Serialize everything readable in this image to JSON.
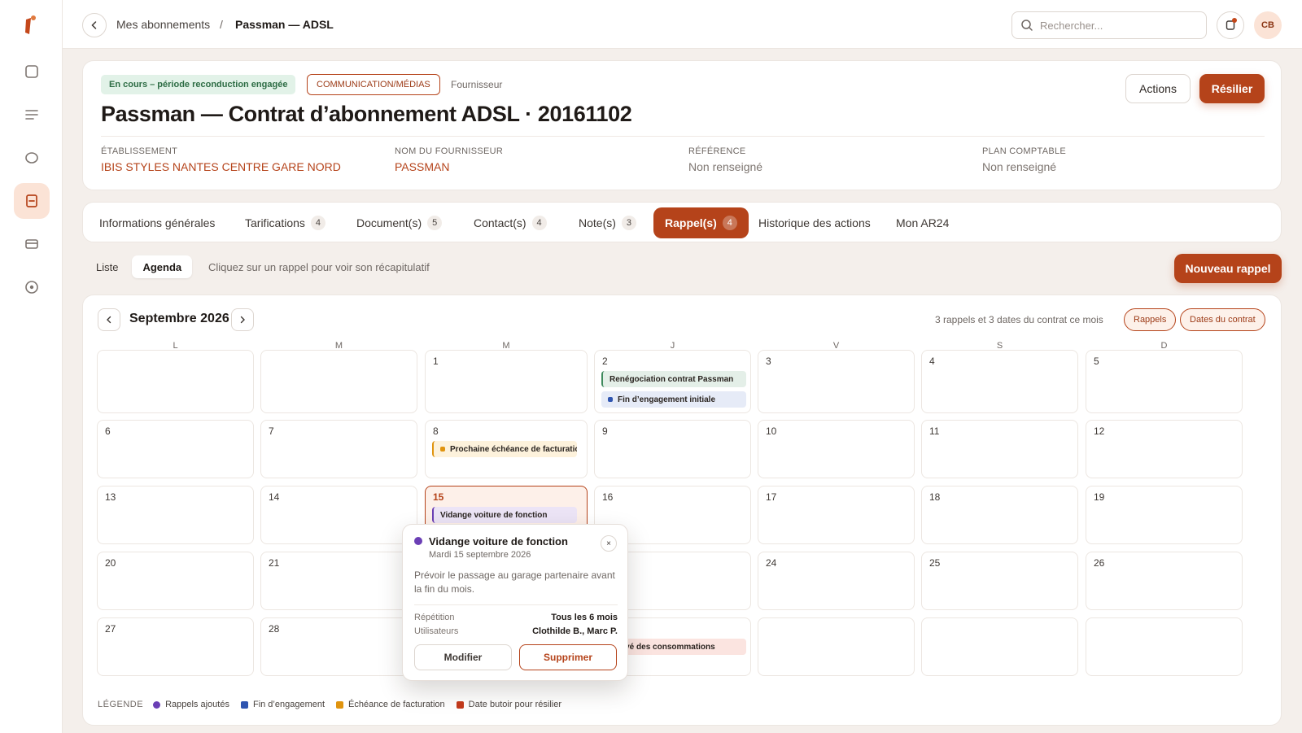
{
  "topbar": {
    "breadcrumb_parent": "Mes abonnements",
    "breadcrumb_separator": "/",
    "breadcrumb_current": "Passman — ADSL",
    "search_placeholder": "Rechercher...",
    "avatar_initials": "CB"
  },
  "sidebar": {
    "items": [
      {
        "icon": "square-icon"
      },
      {
        "icon": "list-icon"
      },
      {
        "icon": "circle-icon"
      },
      {
        "icon": "contract-icon",
        "active": true
      },
      {
        "icon": "card-icon"
      },
      {
        "icon": "target-icon"
      }
    ]
  },
  "header": {
    "status_badge": "En cours – période reconduction engagée",
    "category_badge": "COMMUNICATION/MÉDIAS",
    "supplier_tag": "Fournisseur",
    "title": "Passman — Contrat d’abonnement ADSL · 20161102",
    "actions_label": "Actions",
    "cancel_label": "Résilier",
    "meta": [
      {
        "label": "ÉTABLISSEMENT",
        "value": "IBIS STYLES NANTES CENTRE GARE NORD",
        "style": "link"
      },
      {
        "label": "NOM DU FOURNISSEUR",
        "value": "PASSMAN",
        "style": "link"
      },
      {
        "label": "RÉFÉRENCE",
        "value": "Non renseigné",
        "style": "muted"
      },
      {
        "label": "PLAN COMPTABLE",
        "value": "Non renseigné",
        "style": "muted"
      }
    ]
  },
  "tabs": [
    {
      "label": "Informations générales",
      "count": ""
    },
    {
      "label": "Tarifications",
      "count": "4"
    },
    {
      "label": "Document(s)",
      "count": "5"
    },
    {
      "label": "Contact(s)",
      "count": "4"
    },
    {
      "label": "Note(s)",
      "count": "3"
    },
    {
      "label": "Rappel(s)",
      "count": "4",
      "active": true
    },
    {
      "label": "Historique des actions",
      "count": ""
    },
    {
      "label": "Mon AR24",
      "count": ""
    }
  ],
  "toolbar": {
    "view_list": "Liste",
    "view_agenda": "Agenda",
    "hint": "Cliquez sur un rappel pour voir son récapitulatif",
    "new_reminder": "Nouveau rappel"
  },
  "calendar": {
    "month_label": "Septembre 2026",
    "summary": "3 rappels et 3 dates du contrat ce mois",
    "filter_reminders": "Rappels",
    "filter_dates": "Dates du contrat",
    "weekdays": [
      "L",
      "M",
      "M",
      "J",
      "V",
      "S",
      "D"
    ],
    "weeks": [
      [
        "",
        "",
        "1",
        "2",
        "3",
        "4",
        "5"
      ],
      [
        "6",
        "7",
        "8",
        "9",
        "10",
        "11",
        "12"
      ],
      [
        "13",
        "14",
        "15",
        "16",
        "17",
        "18",
        "19"
      ],
      [
        "20",
        "21",
        "22",
        "23",
        "24",
        "25",
        "26"
      ],
      [
        "27",
        "28",
        "29",
        "30",
        "",
        "",
        ""
      ]
    ],
    "selected_day": "15",
    "events": [
      {
        "day": "2",
        "label": "Renégociation contrat Passman",
        "kind": "rappel"
      },
      {
        "day": "2",
        "label": "Fin d’engagement initiale",
        "kind": "engagement"
      },
      {
        "day": "8",
        "label": "Prochaine échéance de facturation",
        "kind": "facturation"
      },
      {
        "day": "15",
        "label": "Vidange voiture de fonction",
        "kind": "rappel_selected"
      },
      {
        "day": "30",
        "label": "Relevé des consommations",
        "kind": "rappel_pink"
      }
    ]
  },
  "popover": {
    "title": "Vidange voiture de fonction",
    "date": "Mardi 15 septembre 2026",
    "close": "×",
    "description": "Prévoir le passage au garage partenaire avant la fin du mois.",
    "repetition_label": "Répétition",
    "repetition_value": "Tous les 6 mois",
    "users_label": "Utilisateurs",
    "users_value": "Clothilde B., Marc P.",
    "edit_label": "Modifier",
    "delete_label": "Supprimer"
  },
  "legend": {
    "title": "LÉGENDE",
    "items": [
      {
        "label": "Rappels ajoutés",
        "color": "#6b3fb5"
      },
      {
        "label": "Fin d’engagement",
        "color": "#2f55b0"
      },
      {
        "label": "Échéance de facturation",
        "color": "#e0940f"
      },
      {
        "label": "Date butoir pour résilier",
        "color": "#c0391b"
      }
    ]
  },
  "colors": {
    "accent": "#b5431a",
    "rappel": "#6b3fb5",
    "engagement": "#2f55b0",
    "facturation": "#e0940f",
    "butoir": "#c0391b"
  }
}
